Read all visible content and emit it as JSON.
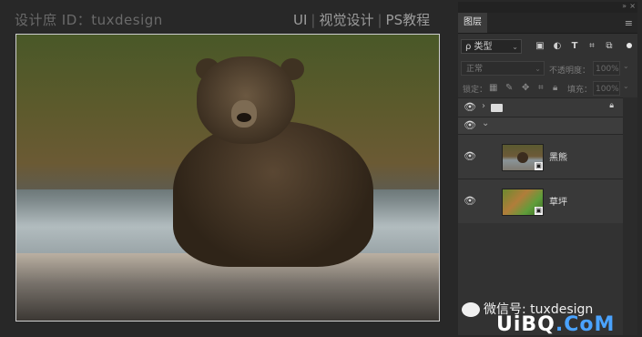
{
  "watermark_top": "设计庶 ID：tuxdesign",
  "top_links": [
    "UI",
    "视觉设计",
    "PS教程"
  ],
  "panel": {
    "collapse_icon": "»",
    "close_icon": "×",
    "tab_label": "图层",
    "menu_icon": "≡",
    "filter": {
      "label": "ρ 类型",
      "icons": [
        "image-filter-icon",
        "adjustment-filter-icon",
        "type-filter-icon",
        "shape-filter-icon",
        "smart-object-filter-icon"
      ]
    },
    "blend_mode": "正常",
    "opacity_label": "不透明度：",
    "opacity_value": "100%",
    "lock_label": "锁定：",
    "fill_label": "填充：",
    "fill_value": "100%"
  },
  "layers": [
    {
      "type": "group",
      "expanded": false,
      "locked": true
    },
    {
      "type": "group",
      "expanded": true
    },
    {
      "name": "黑熊",
      "type": "smart-object"
    },
    {
      "name": "草坪",
      "type": "smart-object"
    }
  ],
  "watermark_bottom": "微信号: tuxdesign",
  "site_logo": {
    "part1": "UiBQ",
    "part2": ".CoM"
  },
  "colors": {
    "background": "#282828",
    "panel": "#323232",
    "accent": "#4aa3ff"
  }
}
